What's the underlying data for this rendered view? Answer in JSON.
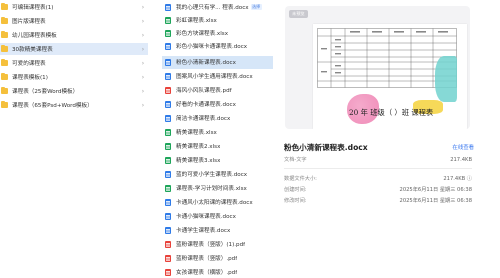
{
  "folders": [
    {
      "label": "可编辑课程表(1)",
      "selected": false
    },
    {
      "label": "图片版课程表",
      "selected": false
    },
    {
      "label": "幼儿园课程表模板",
      "selected": false
    },
    {
      "label": "30款精美课程表",
      "selected": true
    },
    {
      "label": "可爱的课程表",
      "selected": false
    },
    {
      "label": "课程表模板(1)",
      "selected": false
    },
    {
      "label": "课程表（25套Word模板）",
      "selected": false
    },
    {
      "label": "课程表（65套Psd+Word模板）",
      "selected": false
    }
  ],
  "files": [
    {
      "label": "我的心理只有学... 程表.docx",
      "type": "doc",
      "badge": "选择",
      "selected": false
    },
    {
      "label": "彩虹课程表.xlsx",
      "type": "xls",
      "selected": false
    },
    {
      "label": "彩色方块课程表.xlsx",
      "type": "xls",
      "selected": false
    },
    {
      "label": "彩色小猫咪卡通课程表.docx",
      "type": "doc",
      "selected": false
    },
    {
      "label": "粉色小清新课程表.docx",
      "type": "doc",
      "selected": true
    },
    {
      "label": "图案风小学生通用课程表.docx",
      "type": "doc",
      "selected": false
    },
    {
      "label": "海风小风队课程表.pdf",
      "type": "pdf",
      "selected": false
    },
    {
      "label": "好看的卡通课程表.docx",
      "type": "doc",
      "selected": false
    },
    {
      "label": "简洁卡通课程表.docx",
      "type": "doc",
      "selected": false
    },
    {
      "label": "精美课程表.xlsx",
      "type": "xls",
      "selected": false
    },
    {
      "label": "精美课程表2.xlsx",
      "type": "xls",
      "selected": false
    },
    {
      "label": "精美课程表3.xlsx",
      "type": "xls",
      "selected": false
    },
    {
      "label": "蓝的可爱小学生课程表.docx",
      "type": "doc",
      "selected": false
    },
    {
      "label": "课程表-学习计划时间表.xlsx",
      "type": "xls",
      "selected": false
    },
    {
      "label": "卡通风小太阳课的课程表.docx",
      "type": "doc",
      "selected": false
    },
    {
      "label": "卡通小猫咪课程表.docx",
      "type": "doc",
      "selected": false
    },
    {
      "label": "卡通学生课程表.docx",
      "type": "doc",
      "selected": false
    },
    {
      "label": "蓝粉课程表（竖版）(1).pdf",
      "type": "pdf",
      "selected": false
    },
    {
      "label": "蓝粉课程表（竖版）.pdf",
      "type": "pdf",
      "selected": false
    },
    {
      "label": "女孩课程表（横版）.pdf",
      "type": "pdf",
      "selected": false
    }
  ],
  "preview": {
    "tag": "未预览",
    "doc_heading": "20  年  班级（  ）班 课程表",
    "title": "粉色小清新课程表.docx",
    "open_label": "在线查看",
    "meta": [
      {
        "key": "文档-文字",
        "value": "217.4KB"
      },
      {
        "key": "数据文件大小:",
        "value": "217.4KB ⓘ"
      },
      {
        "key": "创建时间:",
        "value": "2025年6月11日 星期三 06:38"
      },
      {
        "key": "修改时间:",
        "value": "2025年6月11日 星期三 06:38"
      }
    ]
  },
  "colors": {
    "selection": "#dfeaf9",
    "file_selection": "#d6e6f8",
    "accent": "#3f7cf0",
    "folder": "#f5c03c",
    "doc": "#2f7be8",
    "xls": "#1ea55a",
    "pdf": "#e8423a"
  }
}
